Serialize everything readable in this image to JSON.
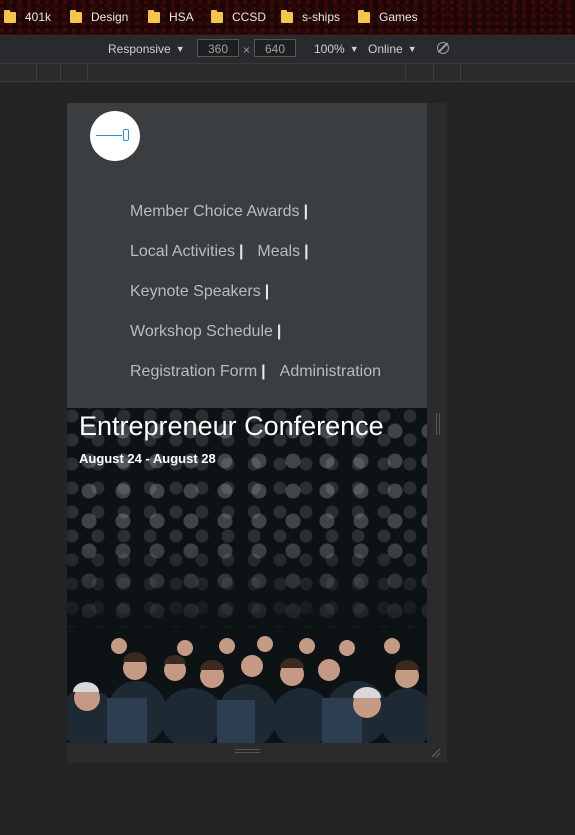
{
  "bookmarks": [
    {
      "label": "401k"
    },
    {
      "label": "Design"
    },
    {
      "label": "HSA"
    },
    {
      "label": "CCSD"
    },
    {
      "label": "s-ships"
    },
    {
      "label": "Games"
    }
  ],
  "device_toolbar": {
    "mode": "Responsive",
    "width": "360",
    "height": "640",
    "times": "×",
    "zoom": "100%",
    "network": "Online",
    "caret": "▼"
  },
  "site": {
    "nav": [
      {
        "label": "Member Choice Awards",
        "sep": "|"
      },
      {
        "label": "Local Activities",
        "sep": "|"
      },
      {
        "label": "Meals",
        "sep": "|"
      },
      {
        "label": "Keynote Speakers",
        "sep": "|"
      },
      {
        "label": "Workshop Schedule",
        "sep": "|"
      },
      {
        "label": "Registration Form",
        "sep": "|"
      },
      {
        "label": "Administration"
      }
    ],
    "hero": {
      "title": "Entrepreneur Conference",
      "dates": "August 24 - August 28"
    }
  },
  "colors": {
    "page_bg": "#3b3e40",
    "nav_text": "#b9bcbe",
    "folder": "#f3c64a"
  }
}
